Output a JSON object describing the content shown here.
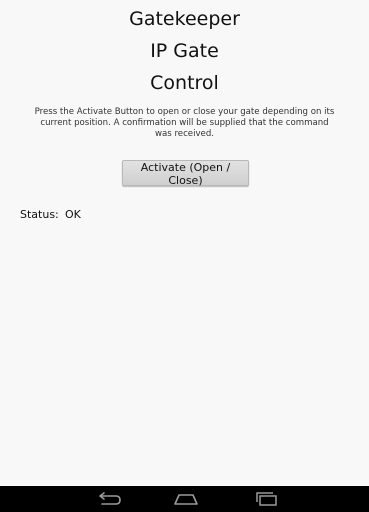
{
  "header": {
    "title_line1": "Gatekeeper",
    "title_line2": "IP Gate",
    "title_line3": "Control"
  },
  "instructions": "Press the Activate Button to open or close your gate depending on its current position. A confirmation will be supplied that the command was received.",
  "activate_button": {
    "label": "Activate (Open / Close)"
  },
  "status": {
    "label": "Status:",
    "value": "OK"
  },
  "navbar": {
    "icons": [
      "back-icon",
      "home-icon",
      "recent-apps-icon"
    ],
    "icon_color": "#9a9a9a",
    "background": "#000000"
  }
}
